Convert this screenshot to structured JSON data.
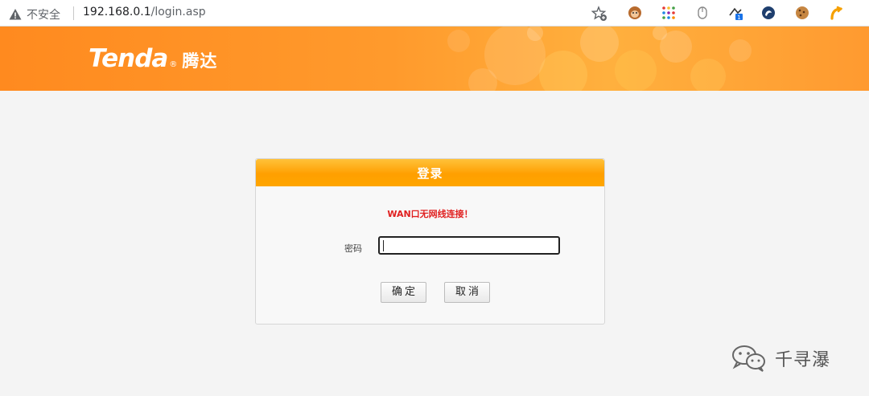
{
  "browser": {
    "security_text": "不安全",
    "url_host": "192.168.0.1",
    "url_path": "/login.asp"
  },
  "header": {
    "logo_latin": "Tenda",
    "logo_mark": "®",
    "logo_cn": "腾达"
  },
  "login": {
    "title": "登录",
    "message": "WAN口无网线连接！",
    "password_label": "密码",
    "password_value": "",
    "ok_label": "确定",
    "cancel_label": "取消"
  },
  "watermark": {
    "text": "千寻瀑"
  },
  "colors": {
    "banner": "#ff9a2c",
    "panel_header": "#ffa600",
    "message": "#e02020"
  },
  "icons": [
    "warning-icon",
    "star-icon",
    "monkey-icon",
    "apps-icon",
    "mouse-icon",
    "ext-badge-icon",
    "logo-circle-icon",
    "cookie-icon",
    "arrow-ext-icon",
    "wechat-icon"
  ]
}
